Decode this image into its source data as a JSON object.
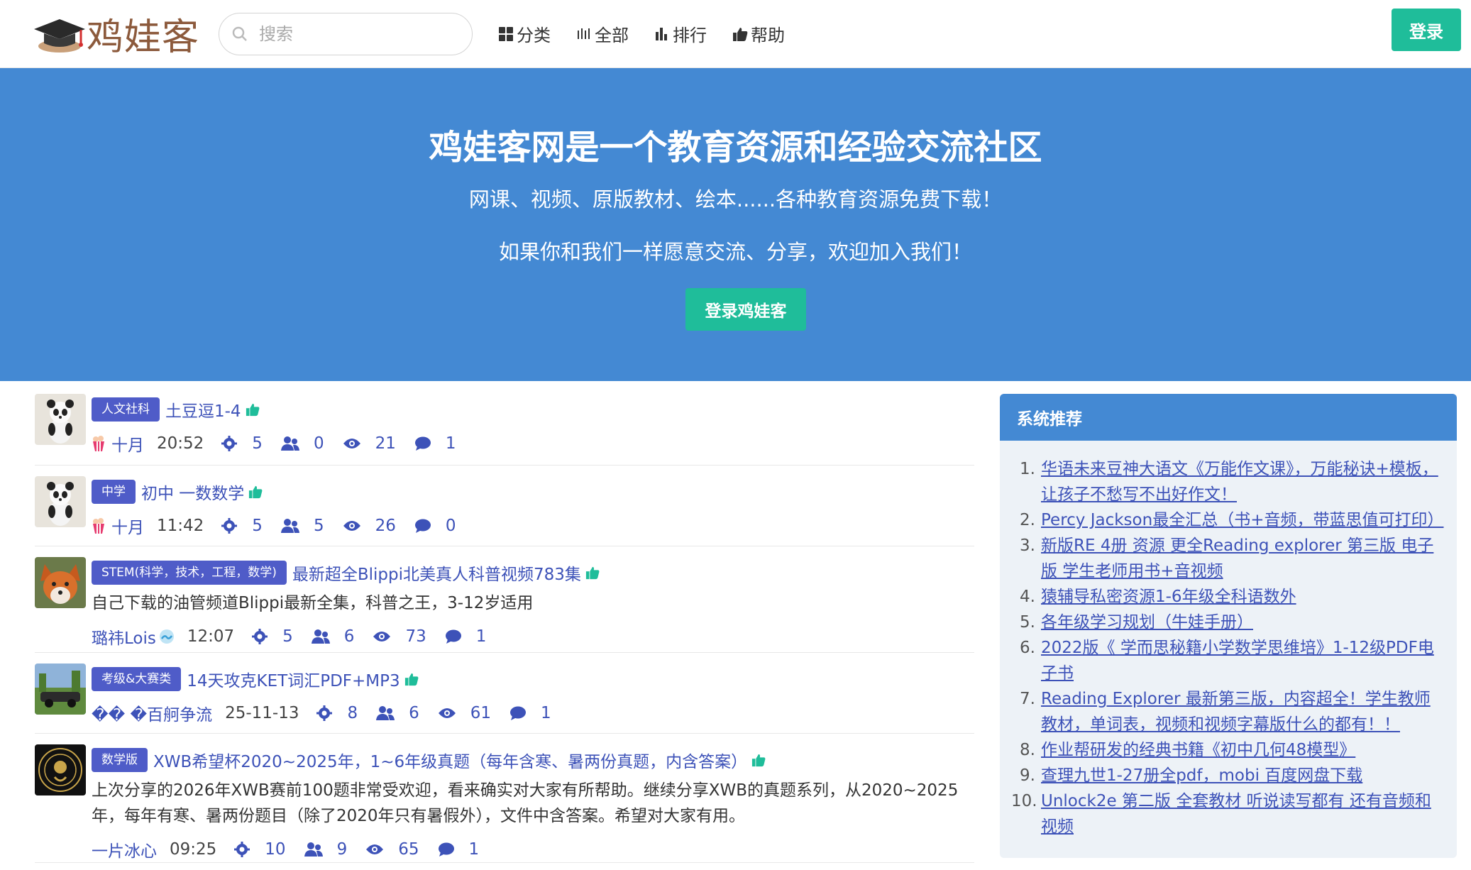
{
  "header": {
    "logo_text": "鸡娃客",
    "search_placeholder": "搜索",
    "nav": [
      {
        "label": "分类",
        "icon": "grid-icon"
      },
      {
        "label": "全部",
        "icon": "bars-icon"
      },
      {
        "label": "排行",
        "icon": "bar-chart-icon"
      },
      {
        "label": "帮助",
        "icon": "thumbs-up-icon"
      }
    ],
    "login_label": "登录"
  },
  "hero": {
    "title": "鸡娃客网是一个教育资源和经验交流社区",
    "subtitle1": "网课、视频、原版教材、绘本......各种教育资源免费下载！",
    "subtitle2": "如果你和我们一样愿意交流、分享，欢迎加入我们！",
    "button": "登录鸡娃客"
  },
  "posts": [
    {
      "tag": "人文社科",
      "title": "土豆逗1-4",
      "desc": "",
      "author": "十月",
      "time": "20:52",
      "likes": "5",
      "users": "0",
      "views": "21",
      "comments": "1",
      "avatar": "panda"
    },
    {
      "tag": "中学",
      "title": "初中 一数数学",
      "desc": "",
      "author": "十月",
      "time": "11:42",
      "likes": "5",
      "users": "5",
      "views": "26",
      "comments": "0",
      "avatar": "panda"
    },
    {
      "tag": "STEM(科学，技术，工程，数学)",
      "title": "最新超全Blippi北美真人科普视频783集",
      "desc": "自己下载的油管频道Blippi最新全集，科普之王，3-12岁适用",
      "author": "璐祎Lois",
      "time": "12:07",
      "likes": "5",
      "users": "6",
      "views": "73",
      "comments": "1",
      "avatar": "fox"
    },
    {
      "tag": "考级&大赛类",
      "title": "14天攻克KET词汇PDF+MP3",
      "desc": "",
      "author": "�� �百舸争流",
      "time": "25-11-13",
      "likes": "8",
      "users": "6",
      "views": "61",
      "comments": "1",
      "avatar": "car"
    },
    {
      "tag": "数学版",
      "title": "XWB希望杯2020~2025年，1~6年级真题（每年含寒、暑两份真题，内含答案）",
      "desc": "上次分享的2026年XWB赛前100题非常受欢迎，看来确实对大家有所帮助。继续分享XWB的真题系列，从2020~2025年，每年有寒、暑两份题目（除了2020年只有暑假外），文件中含答案。希望对大家有用。",
      "author": "一片冰心",
      "time": "09:25",
      "likes": "10",
      "users": "9",
      "views": "65",
      "comments": "1",
      "avatar": "zodiac"
    }
  ],
  "sidebar": {
    "title": "系统推荐",
    "items": [
      "华语未来豆神大语文《万能作文课》，万能秘诀+模板，让孩子不愁写不出好作文！",
      "Percy Jackson最全汇总（书+音频，带蓝思值可打印）",
      "新版RE 4册 资源 更全Reading explorer 第三版 电子版 学生老师用书+音视频",
      "猿辅导私密资源1-6年级全科语数外",
      "各年级学习规划（牛娃手册）",
      "2022版《 学而思秘籍小学数学思维培》1-12级PDF电子书",
      "Reading Explorer 最新第三版，内容超全！学生教师教材，单词表，视频和视频字幕版什么的都有！！",
      "作业帮研发的经典书籍《初中几何48模型》",
      "查理九世1-27册全pdf，mobi 百度网盘下载",
      "Unlock2e 第二版 全套教材 听说读写都有 还有音频和视频"
    ]
  },
  "colors": {
    "brand_blue": "#4489d3",
    "accent_green": "#1fbd9a",
    "tag_purple": "#4f5cc8",
    "link_blue": "#3d52b8"
  }
}
